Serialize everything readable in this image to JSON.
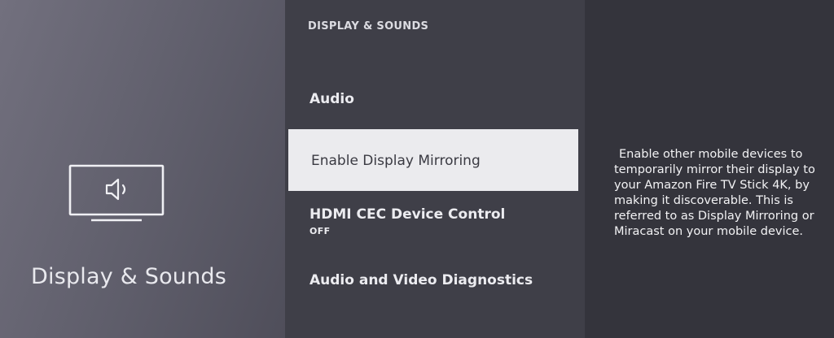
{
  "left": {
    "icon": "tv-speaker-icon",
    "title": "Display & Sounds"
  },
  "menu": {
    "header": "DISPLAY & SOUNDS",
    "items": [
      {
        "label": "Audio",
        "sublabel": "",
        "selected": false
      },
      {
        "label": "Enable Display Mirroring",
        "sublabel": "",
        "selected": true
      },
      {
        "label": "HDMI CEC Device Control",
        "sublabel": "OFF",
        "selected": false
      },
      {
        "label": "Audio and Video Diagnostics",
        "sublabel": "",
        "selected": false
      }
    ]
  },
  "description": {
    "text": "Enable other mobile devices to temporarily mirror their display to your Amazon Fire TV Stick 4K, by making it discoverable. This is referred to as Display Mirroring or Miracast on your mobile device."
  },
  "colors": {
    "selected_bg": "#ebebee",
    "menu_bg": "#3f3f48",
    "text_light": "#ececf0"
  }
}
